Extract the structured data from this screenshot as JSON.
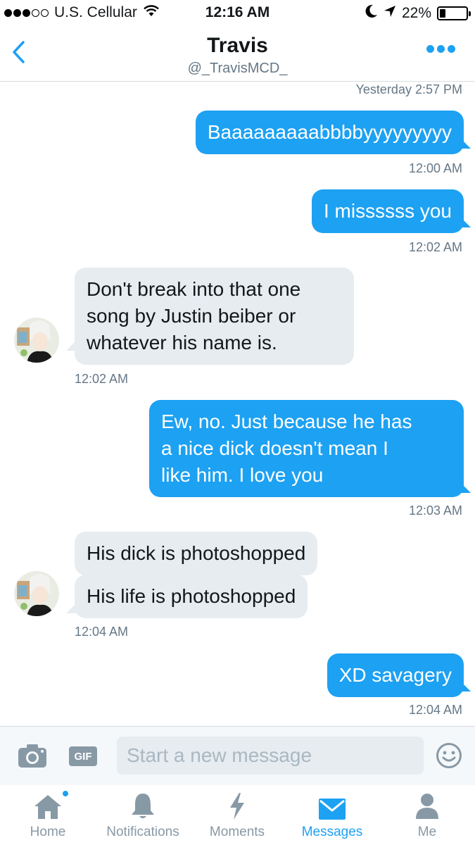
{
  "status_bar": {
    "carrier": "U.S. Cellular",
    "time": "12:16 AM",
    "battery": "22%",
    "battery_level": 0.22,
    "signal_bars_filled": 3,
    "signal_bars_total": 5
  },
  "header": {
    "title": "Travis",
    "handle": "@_TravisMCD_",
    "accent_color": "#1da1f2"
  },
  "messages": {
    "ts_yesterday": "Yesterday 2:57 PM",
    "m1": {
      "text": "Baaaaaaaaabbbbyyyyyyyyy",
      "time": "12:00 AM"
    },
    "m2": {
      "text": "I missssss you",
      "time": "12:02 AM"
    },
    "m3": {
      "line1": "Don't break into that one",
      "line2": "song by Justin beiber or",
      "line3": "whatever his name is.",
      "time": "12:02 AM"
    },
    "m4": {
      "line1": "Ew, no. Just because he has",
      "line2": "a nice dick doesn't mean I",
      "line3": "like him. I love you",
      "time": "12:03 AM"
    },
    "m5a": {
      "text": "His dick is photoshopped"
    },
    "m5b": {
      "text": "His life is photoshopped",
      "time": "12:04 AM"
    },
    "m6": {
      "text": "XD savagery",
      "time": "12:04 AM"
    }
  },
  "composer": {
    "placeholder": "Start a new message",
    "gif_label": "GIF",
    "camera_icon": "camera-icon",
    "emoji_icon": "emoji-icon"
  },
  "tabs": {
    "home": "Home",
    "notifications": "Notifications",
    "moments": "Moments",
    "messages": "Messages",
    "me": "Me",
    "active": "messages"
  }
}
